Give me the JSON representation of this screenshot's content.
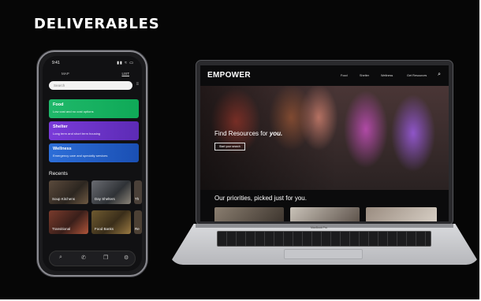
{
  "page": {
    "title": "DELIVERABLES"
  },
  "phone": {
    "time": "9:41",
    "signal": "▮▮ ≈ ▭",
    "tabs": {
      "map": "MAP",
      "list": "LIST"
    },
    "search_placeholder": "Search",
    "filter_icon": "filter-icon",
    "cards": [
      {
        "title": "Food",
        "desc": "Low cost and no cost options",
        "color": "#1fb86a"
      },
      {
        "title": "Shelter",
        "desc": "Long term and short term housing",
        "color": "#7a3bd9"
      },
      {
        "title": "Wellness",
        "desc": "Emergency care and specialty services",
        "color": "#2d6ed8"
      }
    ],
    "recents_label": "Recents",
    "recents": [
      "Soup Kitchens",
      "Day Shelters",
      "Th",
      "Transitional",
      "Food Banks",
      "Re"
    ],
    "nav_icons": [
      "search-icon",
      "phone-icon",
      "bookmark-icon",
      "settings-icon"
    ]
  },
  "laptop": {
    "brand": "EMPOWER",
    "nav": [
      "Food",
      "Shelter",
      "Wellness",
      "Get Resources"
    ],
    "hero_text": "Find Resources for",
    "hero_em": "you.",
    "hero_button": "Start your search",
    "priorities": "Our priorities, picked just for you.",
    "model": "MacBook Pro"
  }
}
